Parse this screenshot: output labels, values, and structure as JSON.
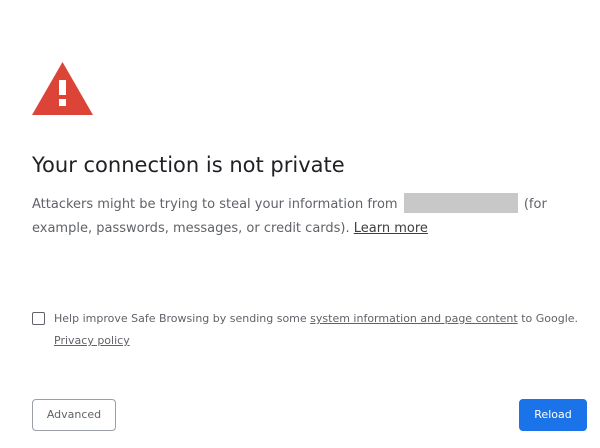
{
  "colors": {
    "warning_red": "#db4437",
    "primary_blue": "#1a73e8",
    "body_text": "#5f6368",
    "heading_text": "#202124"
  },
  "icons": {
    "warning": "warning-triangle-icon"
  },
  "heading": "Your connection is not private",
  "body": {
    "text_before": "Attackers might be trying to steal your information from",
    "text_after": "(for example, passwords, messages, or credit cards).",
    "learn_more": "Learn more"
  },
  "safe_browsing": {
    "text_before": "Help improve Safe Browsing by sending some",
    "link": "system information and page content",
    "text_after": "to Google.",
    "privacy_link": "Privacy policy",
    "checked": false
  },
  "buttons": {
    "advanced": "Advanced",
    "reload": "Reload"
  }
}
